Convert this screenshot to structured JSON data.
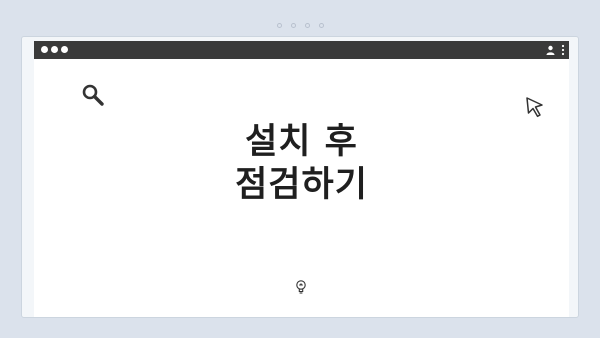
{
  "window": {
    "traffic_lights": [
      "close",
      "minimize",
      "maximize"
    ],
    "toolbar_icons": [
      "profile-icon",
      "kebab-menu-icon"
    ]
  },
  "content": {
    "heading": "설치 후\n점검하기",
    "icons": [
      "search-icon",
      "cursor-pointer-icon",
      "lightbulb-icon"
    ]
  },
  "colors": {
    "background": "#dbe2ec",
    "titlebar": "#3a3a3a",
    "heading": "#1f1f1f"
  }
}
